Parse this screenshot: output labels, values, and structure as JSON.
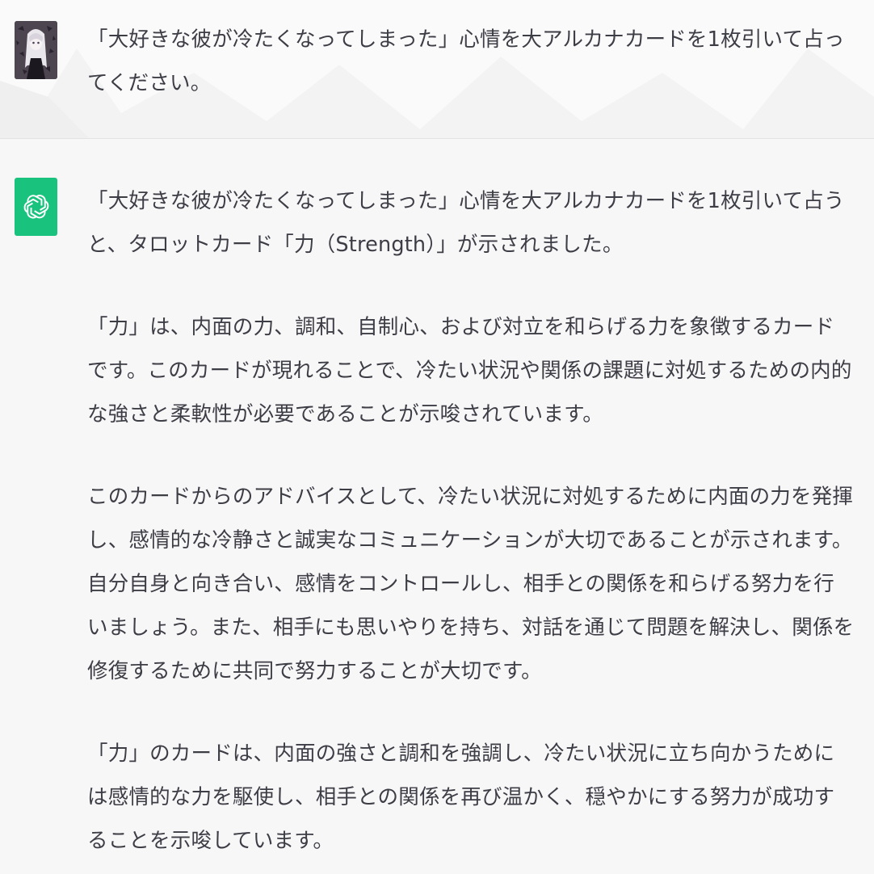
{
  "conversation": {
    "user_message": "「大好きな彼が冷たくなってしまった」心情を大アルカナカードを1枚引いて占ってください。",
    "assistant_paragraphs": [
      "「大好きな彼が冷たくなってしまった」心情を大アルカナカードを1枚引いて占うと、タロットカード「力（Strength）」が示されました。",
      "「力」は、内面の力、調和、自制心、および対立を和らげる力を象徴するカードです。このカードが現れることで、冷たい状況や関係の課題に対処するための内的な強さと柔軟性が必要であることが示唆されています。",
      "このカードからのアドバイスとして、冷たい状況に対処するために内面の力を発揮し、感情的な冷静さと誠実なコミュニケーションが大切であることが示されます。自分自身と向き合い、感情をコントロールし、相手との関係を和らげる努力を行いましょう。また、相手にも思いやりを持ち、対話を通じて問題を解決し、関係を修復するために共同で努力することが大切です。",
      "「力」のカードは、内面の強さと調和を強調し、冷たい状況に立ち向かうためには感情的な力を駆使し、相手との関係を再び温かく、穏やかにする努力が成功することを示唆しています。"
    ]
  },
  "icons": {
    "user_avatar": "user-avatar-image",
    "assistant_avatar": "openai-logo-icon"
  },
  "colors": {
    "assistant_avatar_bg": "#19c37d",
    "user_row_bg": "#fafafa",
    "assistant_row_bg": "#f7f7f8",
    "text": "#3d3d46"
  }
}
